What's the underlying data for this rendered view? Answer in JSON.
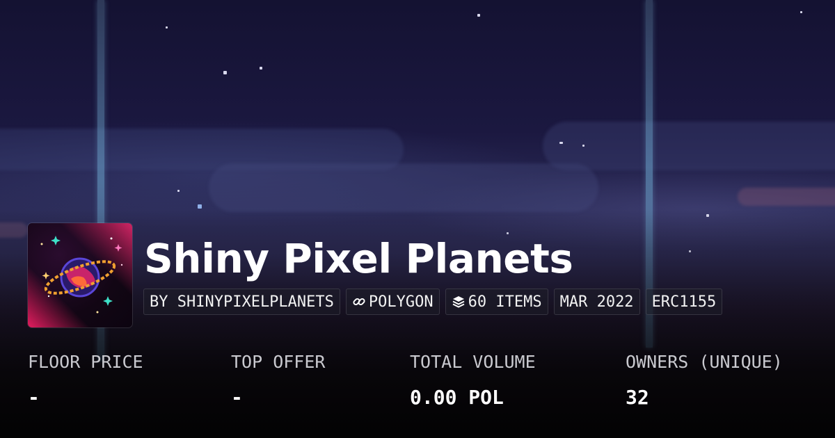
{
  "collection": {
    "title": "Shiny Pixel Planets",
    "badges": [
      {
        "label": "BY SHINYPIXELPLANETS",
        "icon": ""
      },
      {
        "label": "POLYGON",
        "icon": "chain-link-icon"
      },
      {
        "label": "60 ITEMS",
        "icon": "layers-icon"
      },
      {
        "label": "MAR 2022",
        "icon": ""
      },
      {
        "label": "ERC1155",
        "icon": ""
      }
    ]
  },
  "stats": [
    {
      "label": "FLOOR PRICE",
      "value": "-"
    },
    {
      "label": "TOP OFFER",
      "value": "-"
    },
    {
      "label": "TOTAL VOLUME",
      "value": "0.00 POL"
    },
    {
      "label": "OWNERS (UNIQUE)",
      "value": "32"
    }
  ],
  "colors": {
    "background": "#120f2e",
    "accent_pink": "#e8286e",
    "planet_ring": "#f0a030"
  }
}
